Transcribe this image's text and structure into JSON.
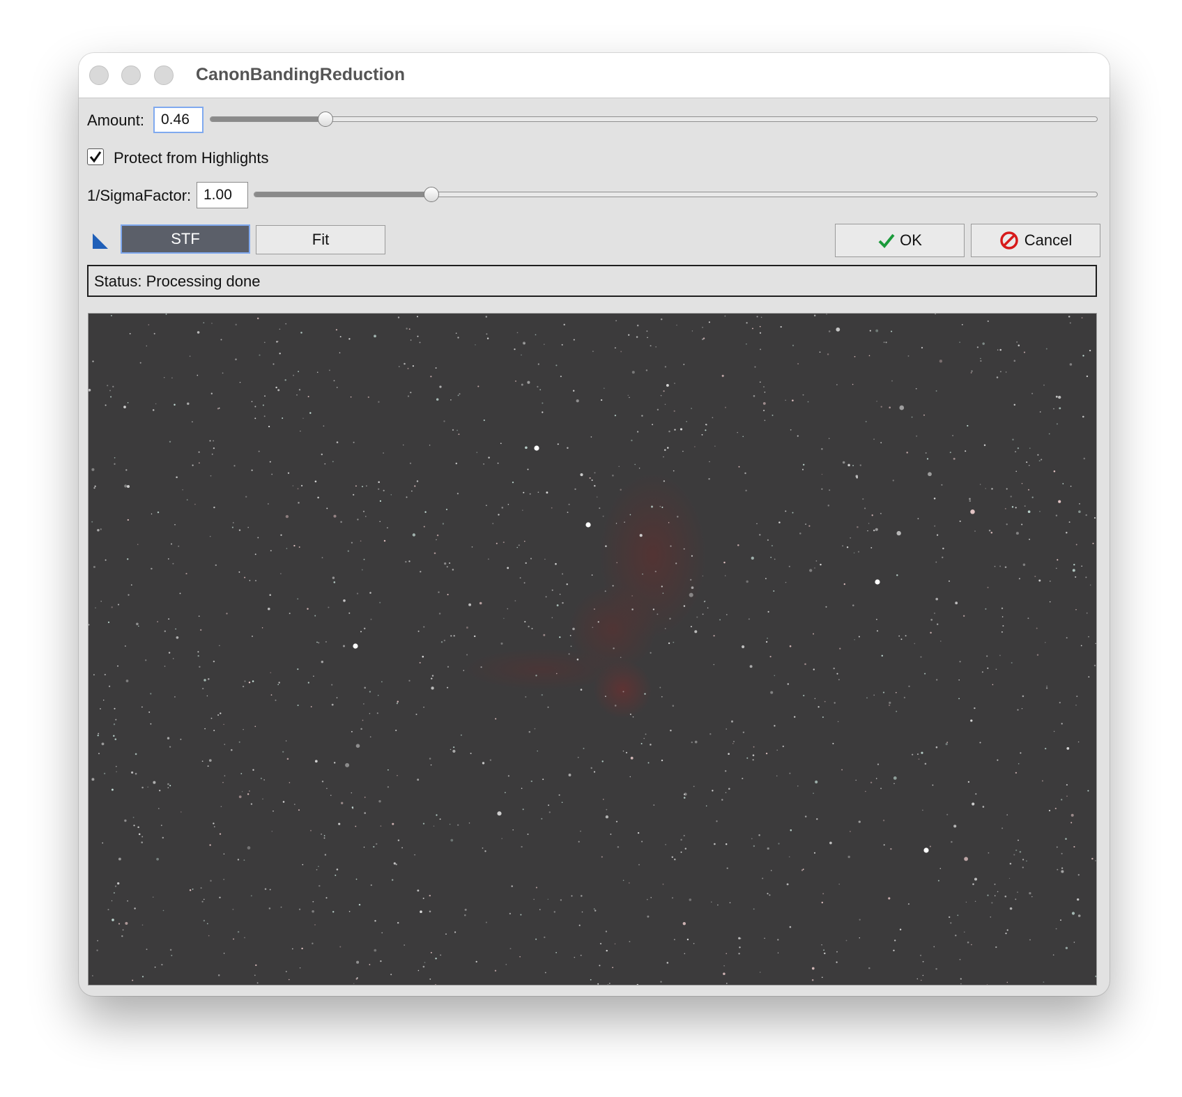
{
  "window": {
    "title": "CanonBandingReduction"
  },
  "amount": {
    "label": "Amount:",
    "value": "0.46",
    "fraction": 0.13
  },
  "protect": {
    "label": "Protect from Highlights",
    "checked": true
  },
  "sigma": {
    "label": "1/SigmaFactor:",
    "value": "1.00",
    "fraction": 0.21
  },
  "buttons": {
    "stf": "STF",
    "fit": "Fit",
    "ok": "OK",
    "cancel": "Cancel"
  },
  "status": {
    "text": "Status: Processing done"
  },
  "icons": {
    "corner": "corner-triangle-icon",
    "ok": "checkmark-icon",
    "cancel": "no-entry-icon",
    "checkbox": "checkmark-icon"
  },
  "colors": {
    "stf_button": "#5b5f69",
    "focus_ring": "#7fa9ef",
    "ok_check": "#1a9a3a",
    "cancel_icon": "#d71a1a",
    "corner_icon": "#1f5fb8"
  }
}
